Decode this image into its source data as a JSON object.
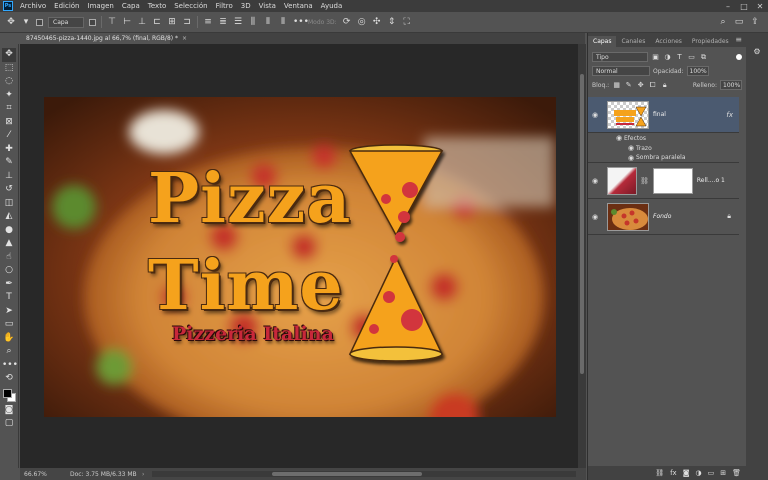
{
  "menubar": {
    "logo": "Ps",
    "items": [
      "Archivo",
      "Edición",
      "Imagen",
      "Capa",
      "Texto",
      "Selección",
      "Filtro",
      "3D",
      "Vista",
      "Ventana",
      "Ayuda"
    ],
    "controls": [
      "–",
      "□",
      "✕"
    ]
  },
  "options_bar": {
    "move_icon": "move-icon",
    "layer_select": "Capa",
    "mode_3d": "Modo 3D:"
  },
  "document": {
    "tab_label": "87450465-pizza-1440.jpg al 66,7% (final, RGB/8) *",
    "close": "×"
  },
  "artwork": {
    "headline_line1": "Pizza",
    "headline_line2": "Time",
    "tagline": "Pizzeria Italina",
    "colors": {
      "orange": "#f5a21c",
      "dark_orange": "#e08a10",
      "red": "#c8283a",
      "pepperoni": "#d2343c",
      "hourglass_top": "#f3c13b"
    }
  },
  "statusbar": {
    "zoom": "66.67%",
    "doc_info": "Doc: 3.75 MB/6.33 MB",
    "arrow": "›"
  },
  "panel": {
    "tabs": [
      "Capas",
      "Canales",
      "Acciones",
      "Propiedades"
    ],
    "active_tab": "Capas",
    "filter": "Tipo",
    "blend_mode": "Normal",
    "opacity_label": "Opacidad:",
    "opacity_value": "100%",
    "lock_label": "Bloq.:",
    "fill_label": "Relleno:",
    "fill_value": "100%",
    "layers": [
      {
        "name": "final",
        "fx": "fx",
        "selected": true,
        "effects_label": "Efectos",
        "effects": [
          "Trazo",
          "Sombra paralela"
        ]
      },
      {
        "name": "Rell....o 1"
      },
      {
        "name": "Fondo"
      }
    ]
  }
}
